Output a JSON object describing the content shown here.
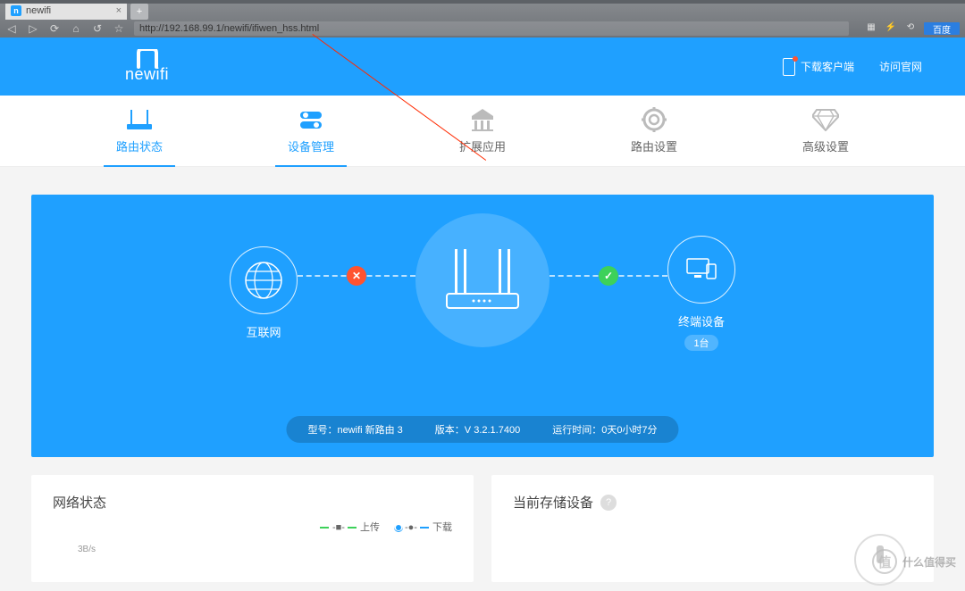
{
  "browser": {
    "tab_title": "newifi",
    "url": "http://192.168.99.1/newifi/ifiwen_hss.html",
    "search_badge": "百度"
  },
  "header": {
    "brand": "newifi",
    "download_client": "下载客户端",
    "visit_site": "访问官网"
  },
  "nav": [
    {
      "label": "路由状态",
      "id": "router-status",
      "active": true
    },
    {
      "label": "设备管理",
      "id": "device-mgmt",
      "active": true
    },
    {
      "label": "扩展应用",
      "id": "extensions"
    },
    {
      "label": "路由设置",
      "id": "router-settings"
    },
    {
      "label": "高级设置",
      "id": "advanced-settings"
    }
  ],
  "status": {
    "internet_label": "互联网",
    "devices_label": "终端设备",
    "devices_count": "1台",
    "model_label": "型号：",
    "model_value": "newifi 新路由 3",
    "version_label": "版本：",
    "version_value": "V 3.2.1.7400",
    "uptime_label": "运行时间：",
    "uptime_value": "0天0小时7分"
  },
  "cards": {
    "network_status_title": "网络状态",
    "legend_upload": "上传",
    "legend_download": "下载",
    "y_tick": "3B/s",
    "storage_title": "当前存储设备"
  },
  "watermark": "什么值得买"
}
